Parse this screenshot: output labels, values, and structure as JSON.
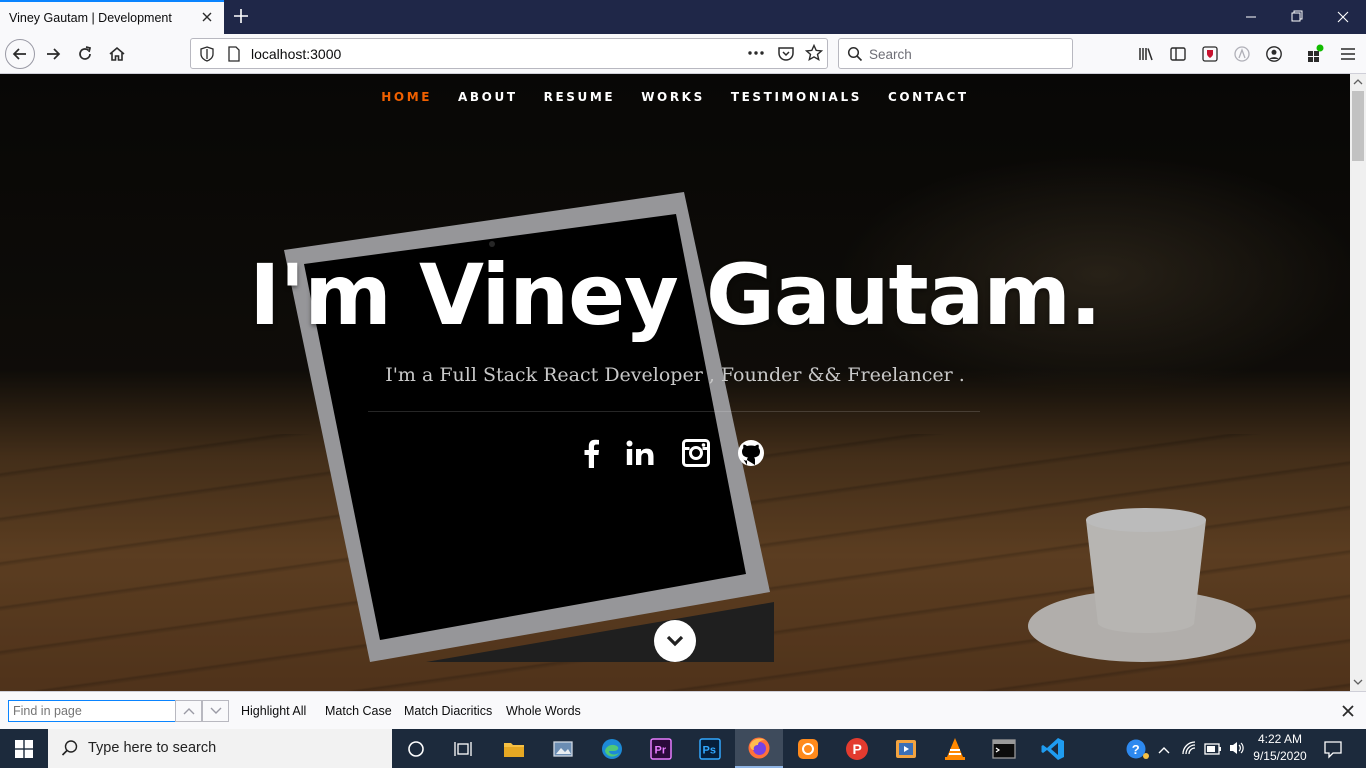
{
  "browser": {
    "tab_title": "Viney Gautam | Development",
    "url": "localhost:3000",
    "search_placeholder": "Search"
  },
  "site": {
    "nav": [
      {
        "label": "HOME",
        "active": true
      },
      {
        "label": "ABOUT",
        "active": false
      },
      {
        "label": "RESUME",
        "active": false
      },
      {
        "label": "WORKS",
        "active": false
      },
      {
        "label": "TESTIMONIALS",
        "active": false
      },
      {
        "label": "CONTACT",
        "active": false
      }
    ],
    "hero_title": "I'm Viney Gautam.",
    "hero_subtitle": "I'm a Full Stack React Developer , Founder && Freelancer .",
    "socials": [
      "facebook-icon",
      "linkedin-icon",
      "instagram-icon",
      "github-icon"
    ],
    "accent_color": "#f06000"
  },
  "findbar": {
    "placeholder": "Find in page",
    "highlight_all": "Highlight All",
    "match_case": "Match Case",
    "match_diacritics": "Match Diacritics",
    "whole_words": "Whole Words"
  },
  "taskbar": {
    "search_placeholder": "Type here to search",
    "time": "4:22 AM",
    "date": "9/15/2020"
  }
}
